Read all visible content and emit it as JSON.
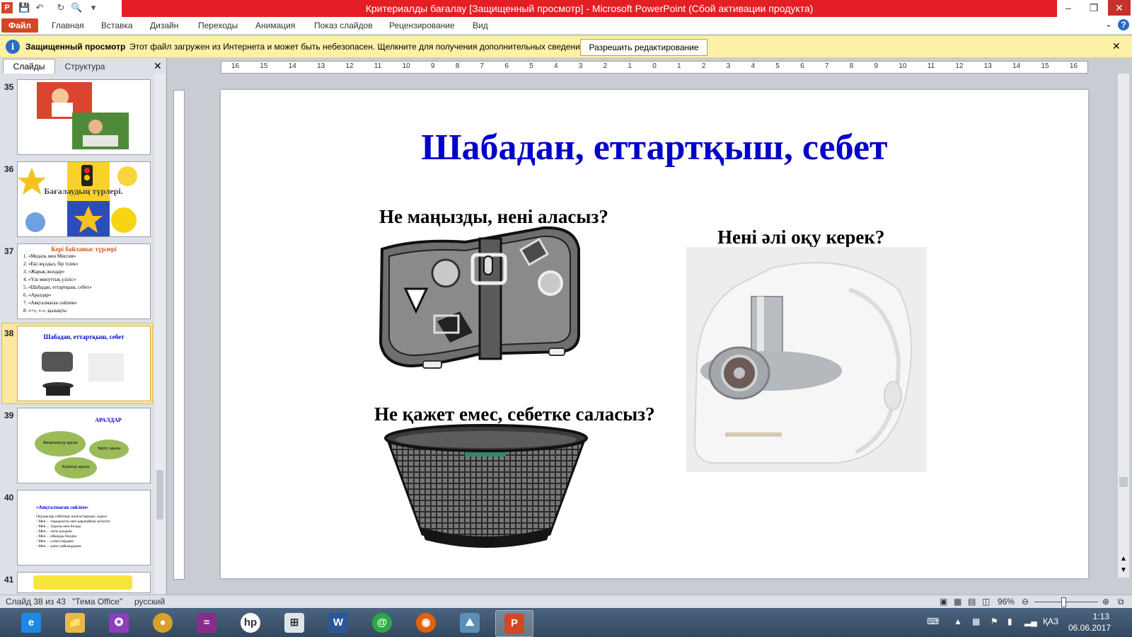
{
  "window": {
    "title": "Критериалды бағалау [Защищенный просмотр] - Microsoft PowerPoint (Сбой активации продукта)"
  },
  "ribbon": {
    "file_tab": "Файл",
    "tabs": [
      "Главная",
      "Вставка",
      "Дизайн",
      "Переходы",
      "Анимация",
      "Показ слайдов",
      "Рецензирование",
      "Вид"
    ]
  },
  "protected_view": {
    "title": "Защищенный просмотр",
    "message": "Этот файл загружен из Интернета и может быть небезопасен. Щелкните для получения дополнительных сведений.",
    "button": "Разрешить редактирование"
  },
  "panel": {
    "tab_slides": "Слайды",
    "tab_outline": "Структура",
    "slides": [
      {
        "number": "35"
      },
      {
        "number": "36",
        "caption": "Бағалаудың түрлері."
      },
      {
        "number": "37",
        "title": "Кері байланыс түрлері",
        "items": [
          "1. «Медаль мен Миссия»",
          "2. «Екі жұлдыз, бір тілек»",
          "3. «Жарық жолдар»",
          "4. «Үш минуттық үзіліс»",
          "5. «Шабадан, еттартқыш, себет»",
          "6. «Аралдар»",
          "7. «Аяқталмаған сөйлем»",
          "8. «+», «-», қызықты"
        ]
      },
      {
        "number": "38",
        "title": "Шабадан, еттартқыш, себет"
      },
      {
        "number": "39",
        "title": "АРАЛДАР",
        "islands": [
          "Жаңалықтар аралы",
          "Зерігу аралы",
          "Күмәнді аралы"
        ]
      },
      {
        "number": "40",
        "title": "«Аяқталмаған сөйлем»",
        "lines": [
          "Оқушылар сөйлемді жалғастырады: қорыт",
          "- Мен ... тақырыпты мен қарапайым жетуиту",
          "- Мен ... туралы мен болды.",
          "- Мен ... тағы қалдым.",
          "- Мен ... ойымды бөлдім",
          "- Мен ... салыстырдым",
          "- Мен ... үшін уайымдадым"
        ]
      },
      {
        "number": "41"
      }
    ]
  },
  "ruler": {
    "ticks": [
      "16",
      "15",
      "14",
      "13",
      "12",
      "11",
      "10",
      "9",
      "8",
      "7",
      "6",
      "5",
      "4",
      "3",
      "2",
      "1",
      "0",
      "1",
      "2",
      "3",
      "4",
      "5",
      "6",
      "7",
      "8",
      "9",
      "10",
      "11",
      "12",
      "13",
      "14",
      "15",
      "16"
    ]
  },
  "slide": {
    "title": "Шабадан, еттартқыш, себет",
    "q1": "Не маңызды, нені аласыз?",
    "q2": "Нені әлі оқу керек?",
    "q3": "Не қажет емес, себетке саласыз?"
  },
  "status": {
    "slide_counter": "Слайд 38 из 43",
    "theme": "\"Тема Office\"",
    "language": "русский",
    "zoom": "96%"
  },
  "taskbar": {
    "language": "ҚАЗ",
    "time": "1:13",
    "date": "06.06.2017"
  },
  "colors": {
    "titlebar": "#e31e24",
    "file_tab": "#d24726",
    "slide_title": "#0000cc",
    "protected_bar": "#fdf1a6"
  }
}
